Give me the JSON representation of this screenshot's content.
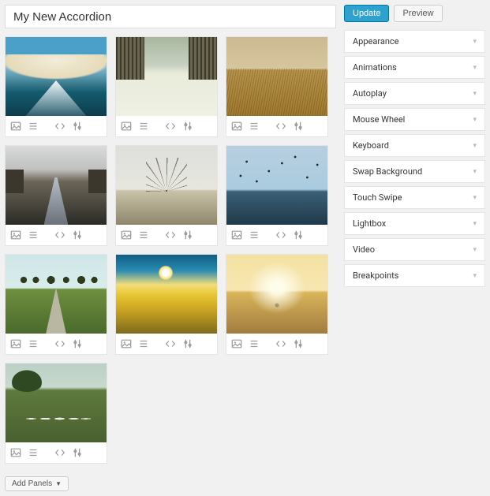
{
  "title": "My New Accordion",
  "buttons": {
    "update": "Update",
    "preview": "Preview",
    "add_panels": "Add Panels"
  },
  "panel_icons": {
    "image": "image-icon",
    "layers": "layers-icon",
    "code": "code-icon",
    "settings": "sliders-icon"
  },
  "panels": [
    {
      "thumb": "t1"
    },
    {
      "thumb": "t2"
    },
    {
      "thumb": "t3"
    },
    {
      "thumb": "t4"
    },
    {
      "thumb": "t5"
    },
    {
      "thumb": "t6"
    },
    {
      "thumb": "t7"
    },
    {
      "thumb": "t8"
    },
    {
      "thumb": "t9"
    },
    {
      "thumb": "t10"
    }
  ],
  "sidebar": {
    "items": [
      {
        "label": "Appearance"
      },
      {
        "label": "Animations"
      },
      {
        "label": "Autoplay"
      },
      {
        "label": "Mouse Wheel"
      },
      {
        "label": "Keyboard"
      },
      {
        "label": "Swap Background"
      },
      {
        "label": "Touch Swipe"
      },
      {
        "label": "Lightbox"
      },
      {
        "label": "Video"
      },
      {
        "label": "Breakpoints"
      }
    ]
  }
}
